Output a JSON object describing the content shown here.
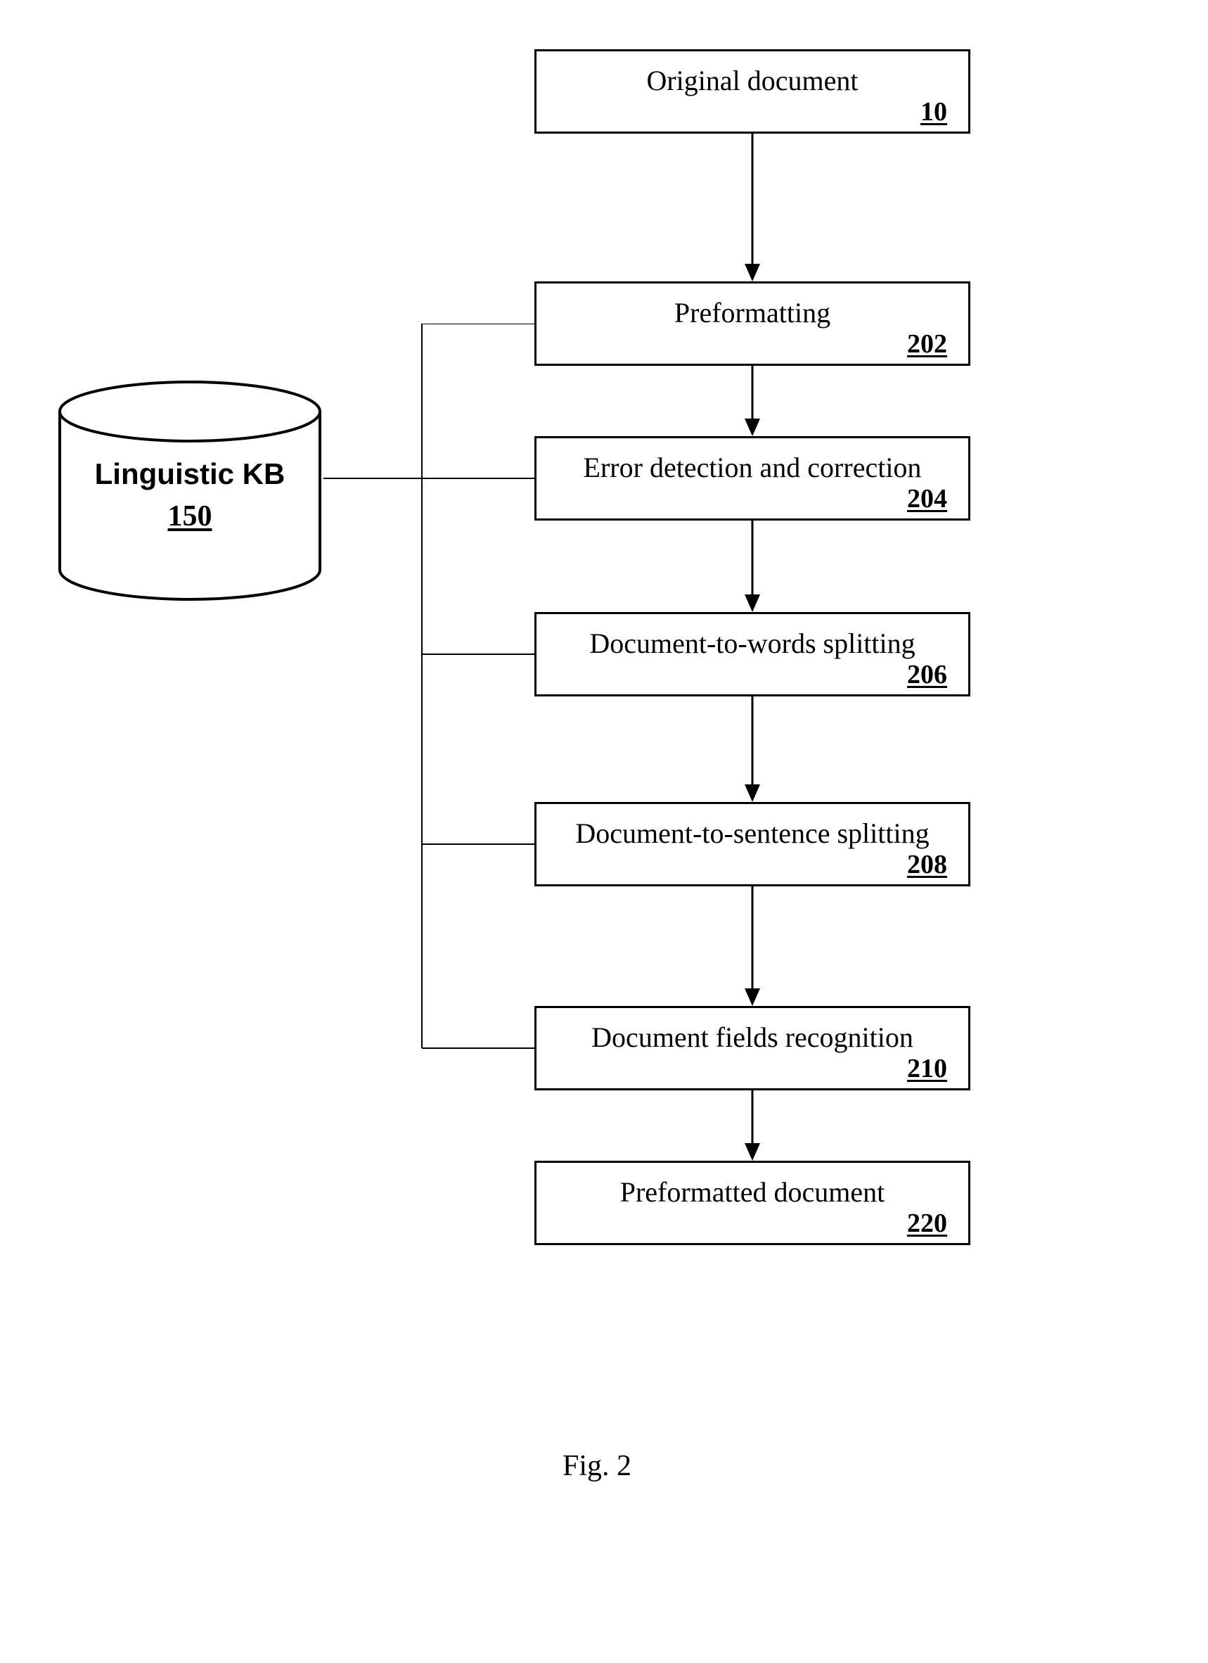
{
  "boxes": {
    "b0": {
      "label": "Original document",
      "ref": "10"
    },
    "b1": {
      "label": "Preformatting",
      "ref": "202"
    },
    "b2": {
      "label": "Error detection and correction",
      "ref": "204"
    },
    "b3": {
      "label": "Document-to-words splitting",
      "ref": "206"
    },
    "b4": {
      "label": "Document-to-sentence splitting",
      "ref": "208"
    },
    "b5": {
      "label": "Document fields recognition",
      "ref": "210"
    },
    "b6": {
      "label": "Preformatted document",
      "ref": "220"
    }
  },
  "kb": {
    "label": "Linguistic KB",
    "ref": "150"
  },
  "caption": "Fig. 2"
}
